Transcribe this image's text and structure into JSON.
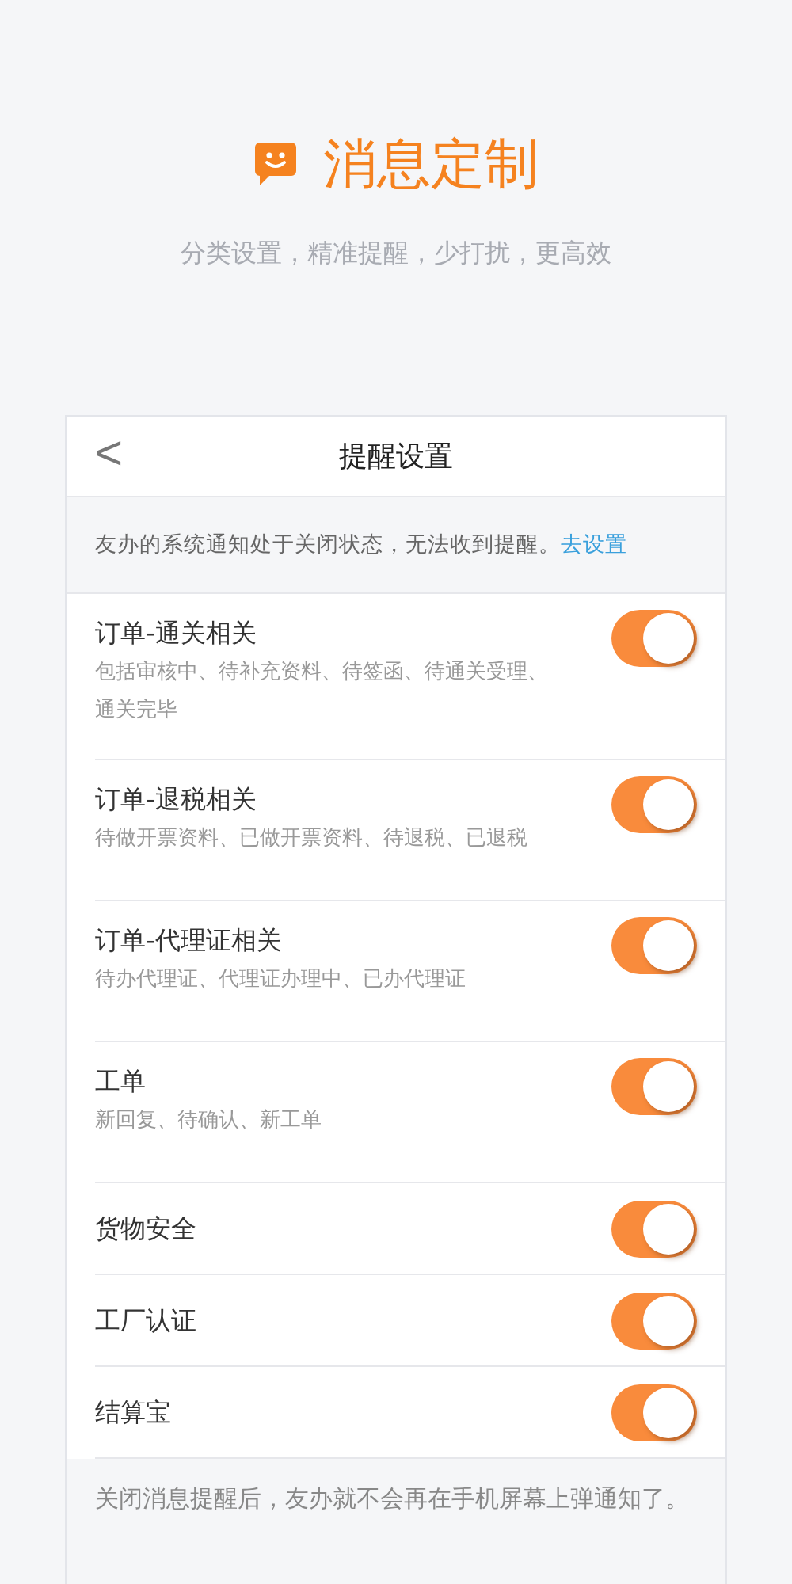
{
  "hero": {
    "title": "消息定制",
    "subtitle": "分类设置，精准提醒，少打扰，更高效"
  },
  "nav": {
    "back": "<",
    "title": "提醒设置"
  },
  "notice": {
    "text": "友办的系统通知处于关闭状态，无法收到提醒。",
    "link": "去设置"
  },
  "settings": [
    {
      "title": "订单-通关相关",
      "description": "包括审核中、待补充资料、待签函、待通关受理、通关完毕",
      "on": true
    },
    {
      "title": "订单-退税相关",
      "description": "待做开票资料、已做开票资料、待退税、已退税",
      "on": true
    },
    {
      "title": "订单-代理证相关",
      "description": "待办代理证、代理证办理中、已办代理证",
      "on": true
    },
    {
      "title": "工单",
      "description": "新回复、待确认、新工单",
      "on": true
    },
    {
      "title": "货物安全",
      "on": true
    },
    {
      "title": "工厂认证",
      "on": true
    },
    {
      "title": "结算宝",
      "on": true
    }
  ],
  "footer": "关闭消息提醒后，友办就不会再在手机屏幕上弹通知了。"
}
